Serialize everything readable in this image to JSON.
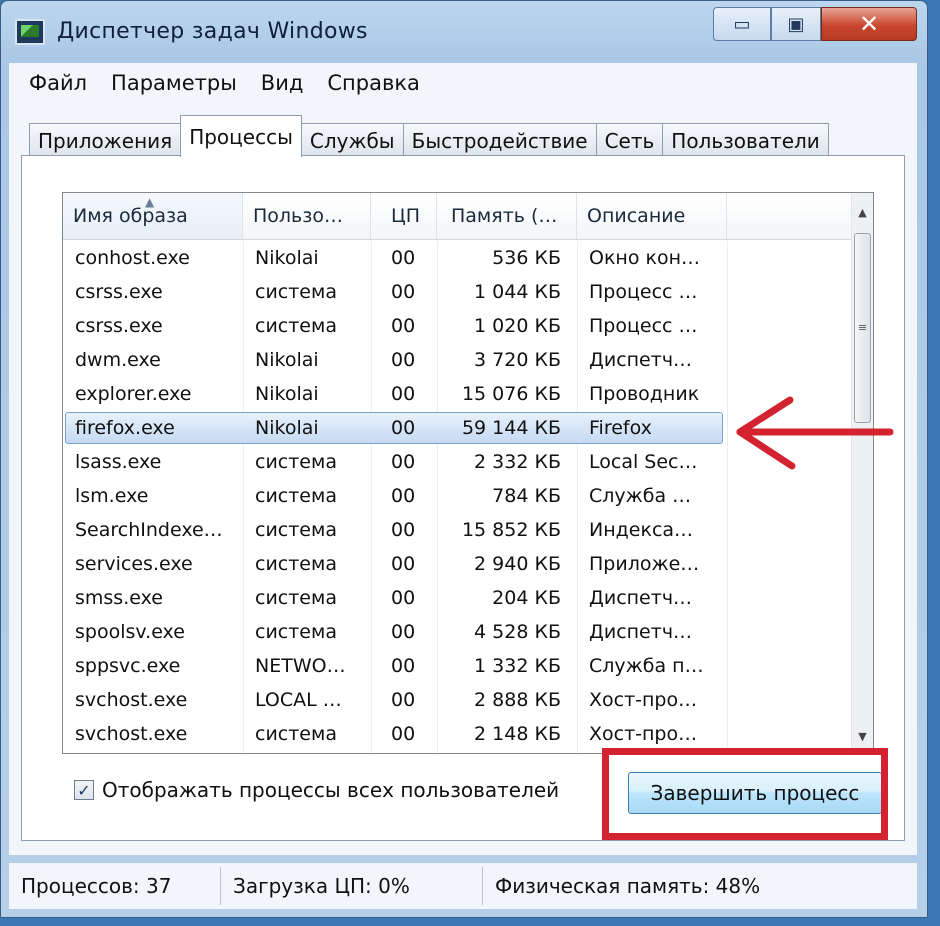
{
  "window": {
    "title": "Диспетчер задач Windows"
  },
  "caption": {
    "minimize": "▭",
    "maximize": "▣",
    "close": "✕"
  },
  "menu": [
    "Файл",
    "Параметры",
    "Вид",
    "Справка"
  ],
  "tabs": [
    "Приложения",
    "Процессы",
    "Службы",
    "Быстродействие",
    "Сеть",
    "Пользователи"
  ],
  "active_tab": "Процессы",
  "columns": [
    "Имя образа",
    "Пользо…",
    "ЦП",
    "Память (…",
    "Описание"
  ],
  "rows": [
    {
      "name": "conhost.exe",
      "user": "Nikolai",
      "cpu": "00",
      "mem": "536 КБ",
      "desc": "Окно кон…"
    },
    {
      "name": "csrss.exe",
      "user": "система",
      "cpu": "00",
      "mem": "1 044 КБ",
      "desc": "Процесс …"
    },
    {
      "name": "csrss.exe",
      "user": "система",
      "cpu": "00",
      "mem": "1 020 КБ",
      "desc": "Процесс …"
    },
    {
      "name": "dwm.exe",
      "user": "Nikolai",
      "cpu": "00",
      "mem": "3 720 КБ",
      "desc": "Диспетч…"
    },
    {
      "name": "explorer.exe",
      "user": "Nikolai",
      "cpu": "00",
      "mem": "15 076 КБ",
      "desc": "Проводник"
    },
    {
      "name": "firefox.exe",
      "user": "Nikolai",
      "cpu": "00",
      "mem": "59 144 КБ",
      "desc": "Firefox"
    },
    {
      "name": "lsass.exe",
      "user": "система",
      "cpu": "00",
      "mem": "2 332 КБ",
      "desc": "Local Sec…"
    },
    {
      "name": "lsm.exe",
      "user": "система",
      "cpu": "00",
      "mem": "784 КБ",
      "desc": "Служба …"
    },
    {
      "name": "SearchIndexe…",
      "user": "система",
      "cpu": "00",
      "mem": "15 852 КБ",
      "desc": "Индекса…"
    },
    {
      "name": "services.exe",
      "user": "система",
      "cpu": "00",
      "mem": "2 940 КБ",
      "desc": "Приложе…"
    },
    {
      "name": "smss.exe",
      "user": "система",
      "cpu": "00",
      "mem": "204 КБ",
      "desc": "Диспетч…"
    },
    {
      "name": "spoolsv.exe",
      "user": "система",
      "cpu": "00",
      "mem": "4 528 КБ",
      "desc": "Диспетч…"
    },
    {
      "name": "sppsvc.exe",
      "user": "NETWO…",
      "cpu": "00",
      "mem": "1 332 КБ",
      "desc": "Служба п…"
    },
    {
      "name": "svchost.exe",
      "user": "LOCAL …",
      "cpu": "00",
      "mem": "2 888 КБ",
      "desc": "Хост-про…"
    },
    {
      "name": "svchost.exe",
      "user": "система",
      "cpu": "00",
      "mem": "2 148 КБ",
      "desc": "Хост-про…"
    }
  ],
  "selected_row": "firefox.exe",
  "show_all": {
    "label": "Отображать процессы всех пользователей",
    "checked": true,
    "mark": "✓"
  },
  "end_process_label": "Завершить процесс",
  "status": {
    "processes": "Процессов: 37",
    "cpu": "Загрузка ЦП: 0%",
    "memory": "Физическая память: 48%"
  },
  "annotation_color": "#d42330",
  "icons": {
    "sort": "sort-asc-icon",
    "scroll_up": "scroll-up-icon",
    "scroll_down": "scroll-down-icon"
  }
}
